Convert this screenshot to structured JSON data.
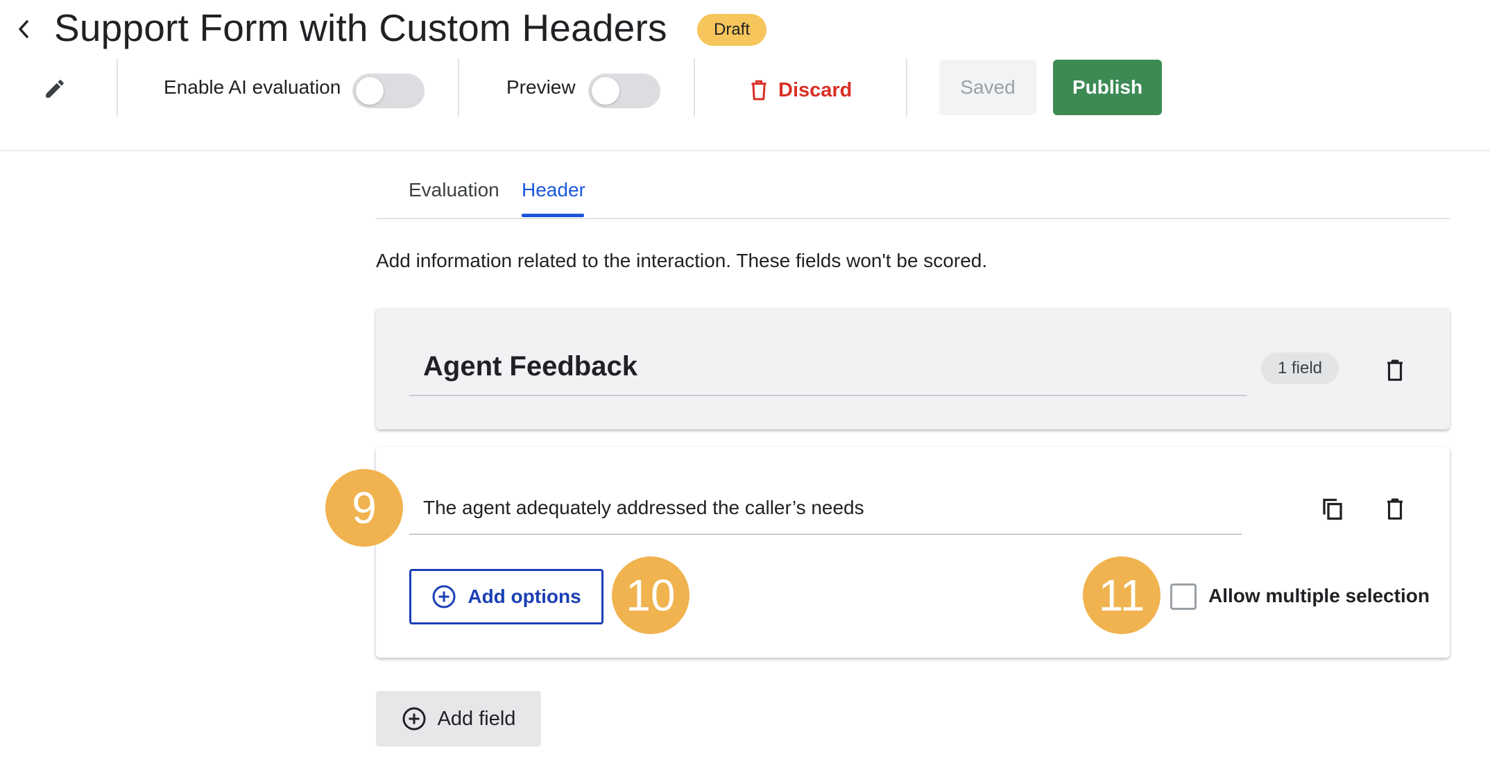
{
  "header": {
    "title": "Support Form with Custom Headers",
    "status_badge": "Draft"
  },
  "toolbar": {
    "ai_evaluation_label": "Enable AI evaluation",
    "ai_evaluation_enabled": false,
    "preview_label": "Preview",
    "preview_enabled": false,
    "discard_label": "Discard",
    "saved_label": "Saved",
    "publish_label": "Publish"
  },
  "tabs": [
    {
      "label": "Evaluation",
      "active": false
    },
    {
      "label": "Header",
      "active": true
    }
  ],
  "description": "Add information related to the interaction. These fields won't be scored.",
  "section": {
    "title": "Agent Feedback",
    "field_count": "1 field"
  },
  "field": {
    "question": "The agent adequately addressed the caller’s needs",
    "add_options_label": "Add options",
    "allow_multiple_label": "Allow multiple selection",
    "allow_multiple_checked": false
  },
  "callouts": [
    "9",
    "10",
    "11"
  ],
  "add_field_label": "Add field",
  "colors": {
    "accent_blue": "#1a56db",
    "publish_green": "#3d8a55",
    "discard_red": "#d93025",
    "badge_yellow": "#f6c55b",
    "callout_orange": "#f0b34f"
  }
}
